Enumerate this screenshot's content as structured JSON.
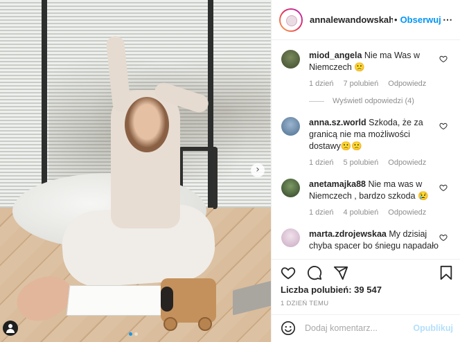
{
  "post": {
    "username": "annalewandowskahpba",
    "separator": "•",
    "follow_label": "Obserwuj",
    "more_icon": "more-options-icon",
    "carousel_dots": 2,
    "carousel_active": 0
  },
  "comments": [
    {
      "user": "miod_angela",
      "text": "Nie ma Was w Niemczech 🙁",
      "time": "1 dzień",
      "likes": "7 polubień",
      "reply": "Odpowiedz",
      "avatar_color": "#5e6b4a"
    },
    {
      "user": "anna.sz.world",
      "text": "Szkoda, że za granicą nie ma możliwości dostawy🙁🙁",
      "time": "1 dzień",
      "likes": "5 polubień",
      "reply": "Odpowiedz",
      "avatar_color": "#6a88a8"
    },
    {
      "user": "anetamajka88",
      "text": "Nie ma was w Niemczech , bardzo szkoda 😢",
      "time": "1 dzień",
      "likes": "4 polubień",
      "reply": "Odpowiedz",
      "avatar_color": "#4f6a3f"
    },
    {
      "user": "marta.zdrojewskaa",
      "text": "My dzisiaj chyba spacer bo śniegu napadało",
      "avatar_color": "#d9c4d6"
    }
  ],
  "view_replies": "Wyświetl odpowiedzi (4)",
  "actions": {
    "like_icon": "heart-icon",
    "comment_icon": "comment-icon",
    "share_icon": "share-icon",
    "save_icon": "bookmark-icon"
  },
  "likes_text": "Liczba polubień: 39 547",
  "date_text": "1 DZIEŃ TEMU",
  "add_comment": {
    "emoji_icon": "emoji-icon",
    "placeholder": "Dodaj komentarz...",
    "post_label": "Opublikuj"
  },
  "colors": {
    "link_blue": "#0095f6",
    "post_disabled": "#b2dffc",
    "meta_gray": "#8e8e8e"
  }
}
